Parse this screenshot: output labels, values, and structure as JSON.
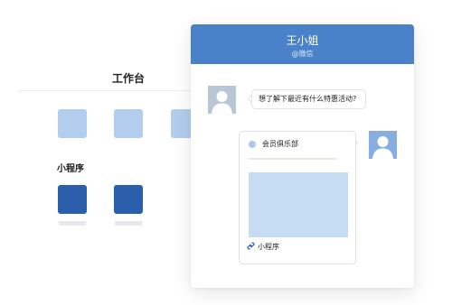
{
  "workspace": {
    "title": "工作台",
    "mini_programs_title": "小程序"
  },
  "chat": {
    "contact_name": "王小姐",
    "contact_channel": "@微信",
    "incoming_message": "想了解下最近有什么特惠活动?",
    "card": {
      "title": "会员俱乐部",
      "footer_label": "小程序",
      "footer_icon": "mini-program-link-icon"
    }
  },
  "colors": {
    "header": "#4a82c9",
    "app_tile": "#b3cdee",
    "mini_program_tile": "#2b5eab",
    "card_image": "#c6dcf3"
  }
}
